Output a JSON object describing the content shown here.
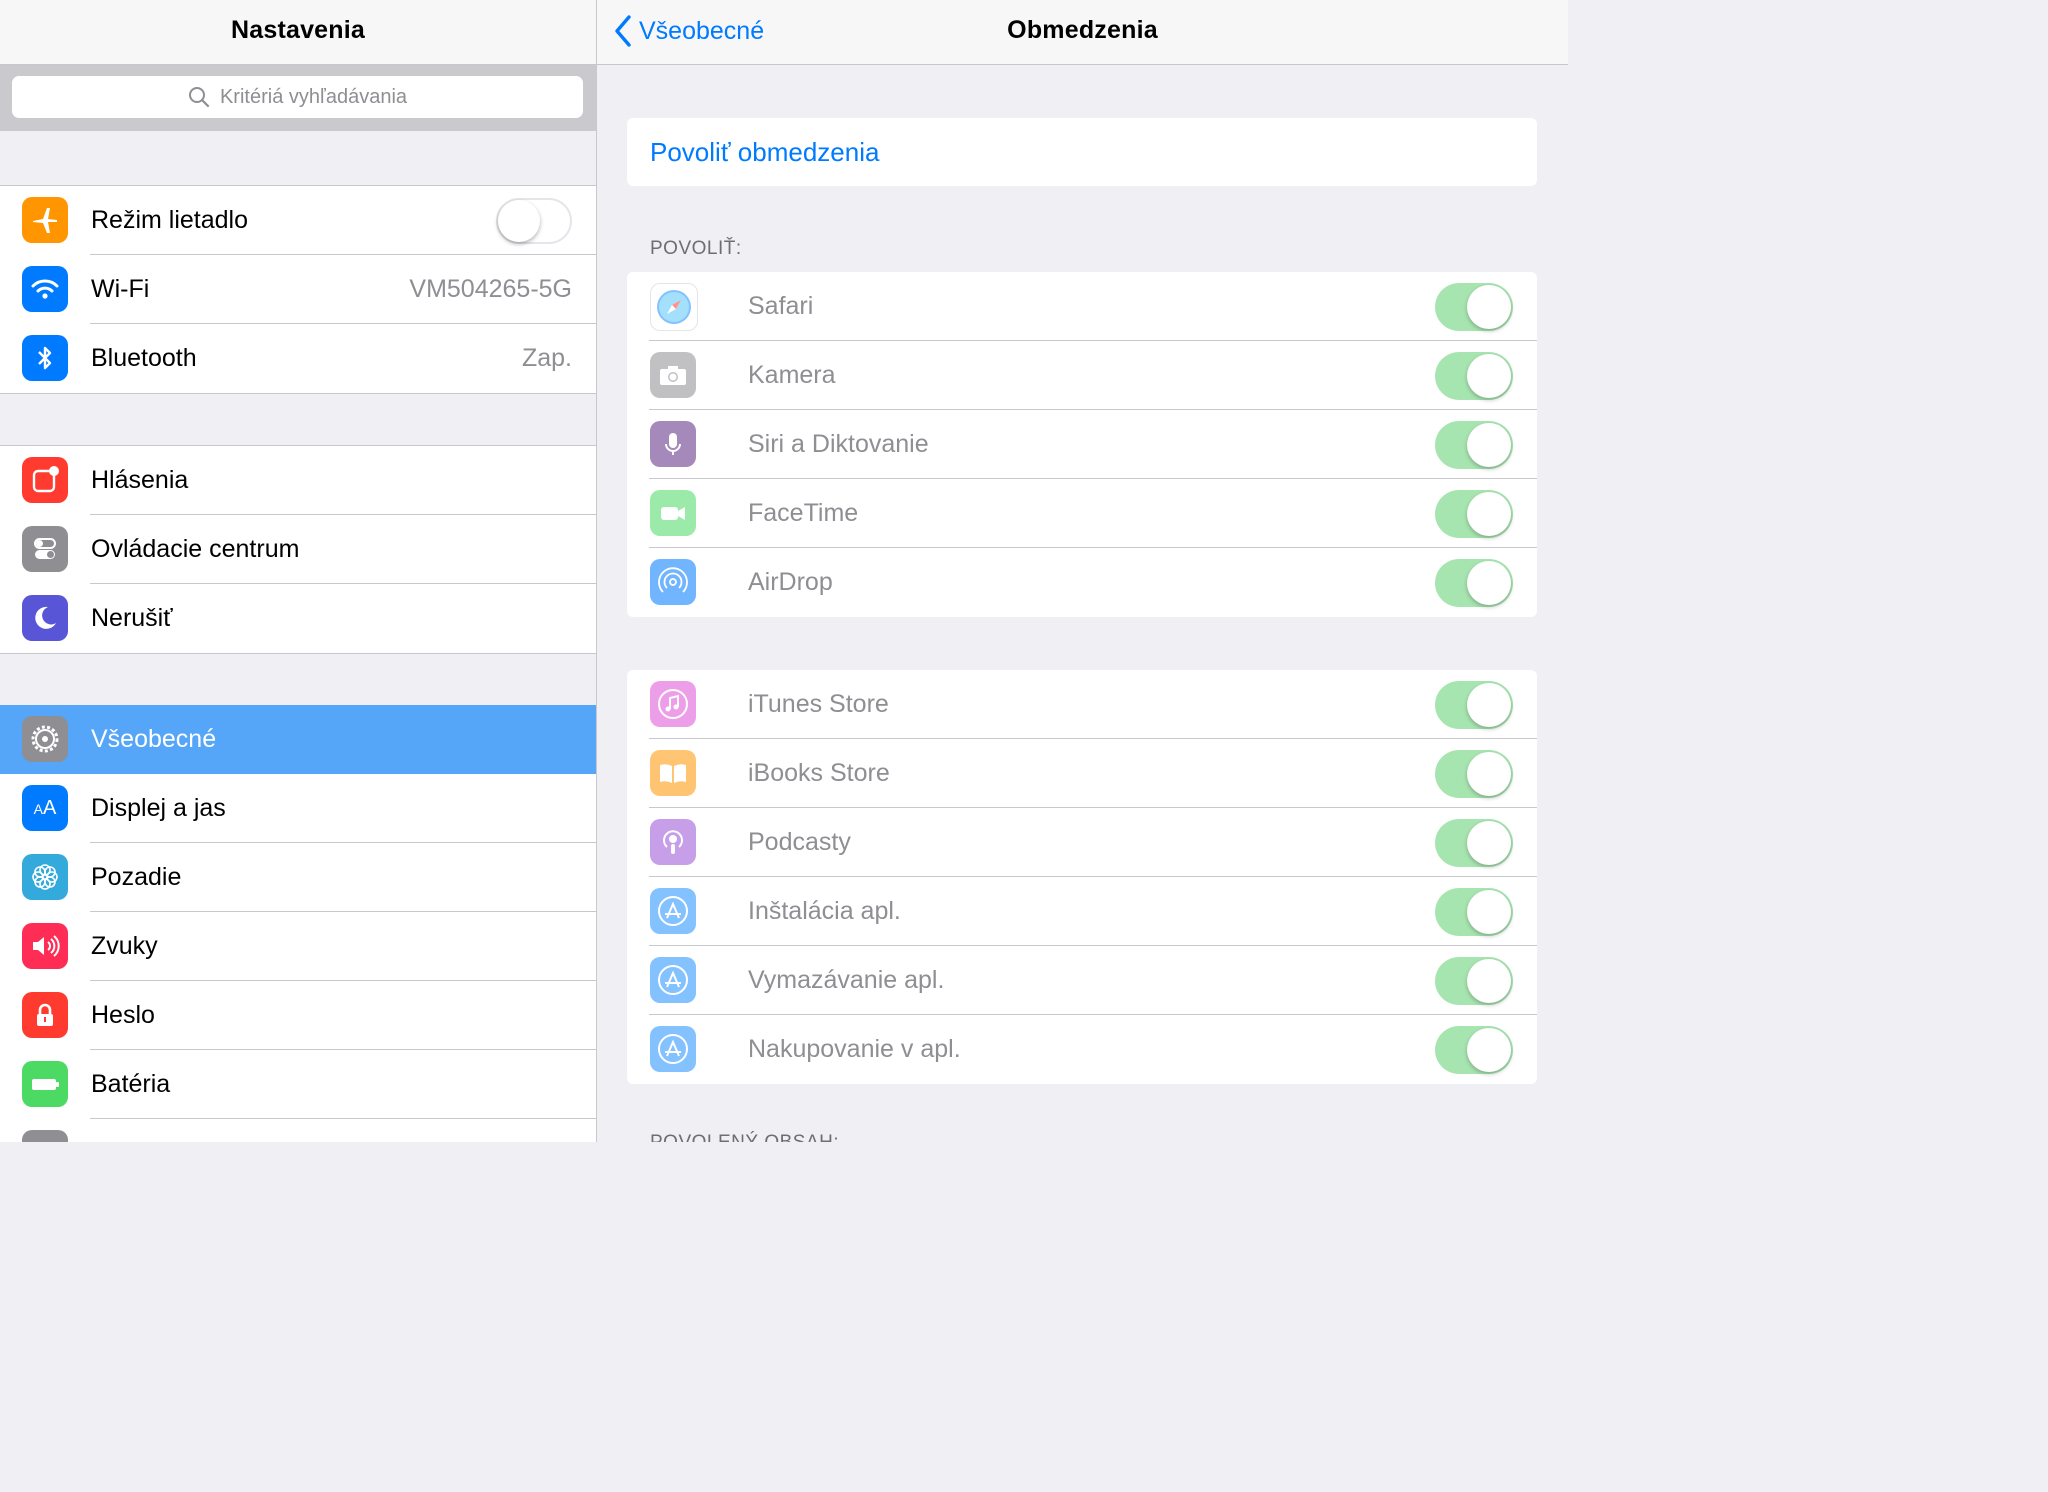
{
  "left": {
    "title": "Nastavenia",
    "search_placeholder": "Kritériá vyhľadávania",
    "groups": [
      [
        {
          "label": "Režim lietadlo",
          "icon": "airplane-icon",
          "color": "#ff9500",
          "toggle": false
        },
        {
          "label": "Wi-Fi",
          "icon": "wifi-icon",
          "color": "#007aff",
          "value": "VM504265-5G"
        },
        {
          "label": "Bluetooth",
          "icon": "bluetooth-icon",
          "color": "#007aff",
          "value": "Zap."
        }
      ],
      [
        {
          "label": "Hlásenia",
          "icon": "notifications-icon",
          "color": "#ff3b30"
        },
        {
          "label": "Ovládacie centrum",
          "icon": "control-center-icon",
          "color": "#8e8e93"
        },
        {
          "label": "Nerušiť",
          "icon": "moon-icon",
          "color": "#5856d6"
        }
      ],
      [
        {
          "label": "Všeobecné",
          "icon": "gear-icon",
          "color": "#8e8e93",
          "selected": true
        },
        {
          "label": "Displej a jas",
          "icon": "display-icon",
          "color": "#007aff"
        },
        {
          "label": "Pozadie",
          "icon": "wallpaper-icon",
          "color": "#34aadc"
        },
        {
          "label": "Zvuky",
          "icon": "sounds-icon",
          "color": "#ff2d55"
        },
        {
          "label": "Heslo",
          "icon": "lock-icon",
          "color": "#ff3b30"
        },
        {
          "label": "Batéria",
          "icon": "battery-icon",
          "color": "#4cd964"
        },
        {
          "label": "",
          "icon": "privacy-icon",
          "color": "#8e8e93"
        }
      ]
    ]
  },
  "right": {
    "back_label": "Všeobecné",
    "title": "Obmedzenia",
    "enable_label": "Povoliť obmedzenia",
    "section_allow": "POVOLIŤ:",
    "section_allowed_content": "POVOLENÝ OBSAH:",
    "allow_items": [
      {
        "label": "Safari",
        "icon": "safari-icon",
        "on": true
      },
      {
        "label": "Kamera",
        "icon": "camera-icon",
        "on": true
      },
      {
        "label": "Siri a Diktovanie",
        "icon": "siri-icon",
        "on": true
      },
      {
        "label": "FaceTime",
        "icon": "facetime-icon",
        "on": true
      },
      {
        "label": "AirDrop",
        "icon": "airdrop-icon",
        "on": true
      }
    ],
    "store_items": [
      {
        "label": "iTunes Store",
        "icon": "itunes-icon",
        "on": true
      },
      {
        "label": "iBooks Store",
        "icon": "ibooks-icon",
        "on": true
      },
      {
        "label": "Podcasty",
        "icon": "podcasts-icon",
        "on": true
      },
      {
        "label": "Inštalácia apl.",
        "icon": "appstore-icon",
        "on": true
      },
      {
        "label": "Vymazávanie apl.",
        "icon": "appstore-icon",
        "on": true
      },
      {
        "label": "Nakupovanie v apl.",
        "icon": "appstore-icon",
        "on": true
      }
    ]
  },
  "colors": {
    "accent": "#007aff",
    "selected_row": "#55a5f8",
    "toggle_on": "#a7e5b0"
  }
}
